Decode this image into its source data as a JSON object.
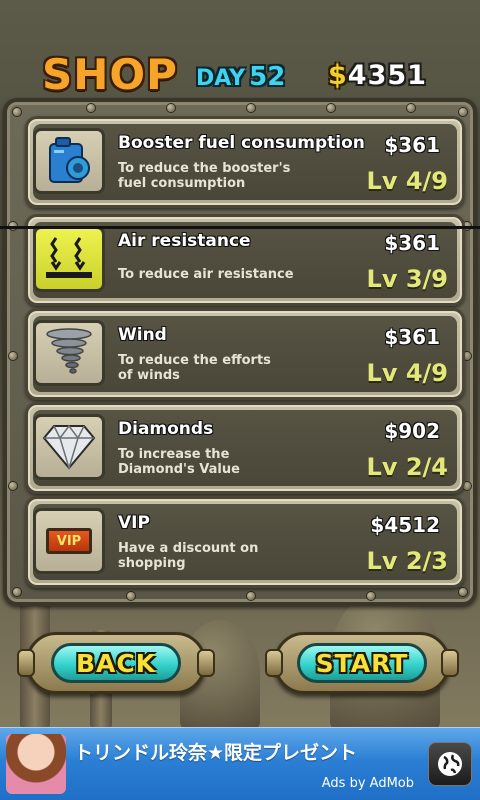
{
  "header": {
    "title": "SHOP",
    "day_label": "DAY",
    "day_number": "52",
    "money_symbol": "$",
    "money_value": "4351"
  },
  "items": [
    {
      "name": "Booster fuel consumption",
      "description": "To reduce the booster's\nfuel consumption",
      "price": "$361",
      "level": "Lv 4/9",
      "icon": "fuel-can-icon"
    },
    {
      "name": "Air resistance",
      "description": "To reduce air resistance",
      "price": "$361",
      "level": "Lv 3/9",
      "icon": "air-resistance-icon"
    },
    {
      "name": "Wind",
      "description": "To reduce the efforts\n of winds",
      "price": "$361",
      "level": "Lv 4/9",
      "icon": "tornado-icon"
    },
    {
      "name": "Diamonds",
      "description": "To increase the\nDiamond's Value",
      "price": "$902",
      "level": "Lv 2/4",
      "icon": "diamond-icon"
    },
    {
      "name": "VIP",
      "description": "Have a discount on\nshopping",
      "price": "$4512",
      "level": "Lv 2/3",
      "icon": "vip-badge-icon",
      "icon_text": "VIP"
    }
  ],
  "buttons": {
    "back_label": "BACK",
    "start_label": "START"
  },
  "ad": {
    "text": "トリンドル玲奈★限定プレゼント",
    "by": "Ads by AdMob",
    "icon": "globe-icon"
  },
  "colors": {
    "title_orange": "#f7a52a",
    "day_cyan": "#3fd3ee",
    "level_yellow": "#e4e87a",
    "button_teal": "#34d3cc",
    "button_text": "#f7e03a",
    "ad_blue": "#2b7fd4"
  }
}
